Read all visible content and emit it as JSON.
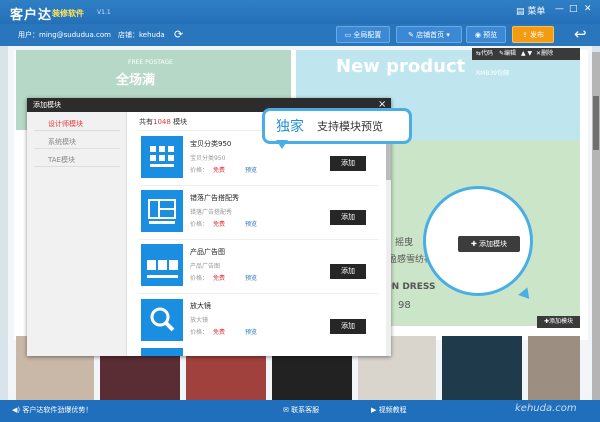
{
  "app": {
    "brand": "客户达",
    "subtitle": "装修软件",
    "version": "V1.1"
  },
  "window_controls": {
    "menu": "菜单",
    "minimize": "—",
    "maximize": "□",
    "close": "✕"
  },
  "user_bar": {
    "user_label": "用户：ming@sududua.com",
    "shop_label": "店铺：kehuda"
  },
  "top_buttons": {
    "global_config": "全局配置",
    "shop_home": "店铺首页",
    "preview": "预览",
    "publish": "发布"
  },
  "module_toolbar": {
    "code": "代码",
    "edit": "编辑",
    "delete": "删除"
  },
  "canvas": {
    "banner1_small": "FREE POSTAGE",
    "banner1_big": "全场满",
    "banner2_big": "New  product",
    "banner2_small": "RMB39包邮",
    "banner3_a": "摇曳",
    "banner3_b": "盈感雪纺衫",
    "banner3_c": "ON DRESS",
    "banner3_d": "98"
  },
  "dialog": {
    "title": "添加模块",
    "close": "×",
    "sidebar": [
      "设计师模块",
      "系统模块",
      "TAE模块"
    ],
    "count_prefix": "共有",
    "count_value": "1048",
    "count_suffix": "模块",
    "modules": [
      {
        "name": "宝贝分类950",
        "sub": "宝贝分类950",
        "price_label": "价格：",
        "price": "免费",
        "preview": "预览",
        "add": "添加"
      },
      {
        "name": "错落广告搭配秀",
        "sub": "错落广告搭配秀",
        "price_label": "价格：",
        "price": "免费",
        "preview": "预览",
        "add": "添加"
      },
      {
        "name": "产品广告图",
        "sub": "产品广告图",
        "price_label": "价格：",
        "price": "免费",
        "preview": "预览",
        "add": "添加"
      },
      {
        "name": "放大镜",
        "sub": "放大镜",
        "price_label": "价格：",
        "price": "免费",
        "preview": "预览",
        "add": "添加"
      }
    ]
  },
  "callout": {
    "exclusive": "独家",
    "text": "支持模块预览"
  },
  "add_module_btn": "添加模块",
  "canvas_add_module": "添加模块",
  "status_bar": {
    "promo": "客户达软件劲爆优势！",
    "support": "联系客服",
    "video": "视频教程",
    "domain": "kehuda.com"
  },
  "colors": {
    "brand_blue": "#2a76bd",
    "accent_red": "#e4393c",
    "publish_orange": "#f39c12"
  }
}
